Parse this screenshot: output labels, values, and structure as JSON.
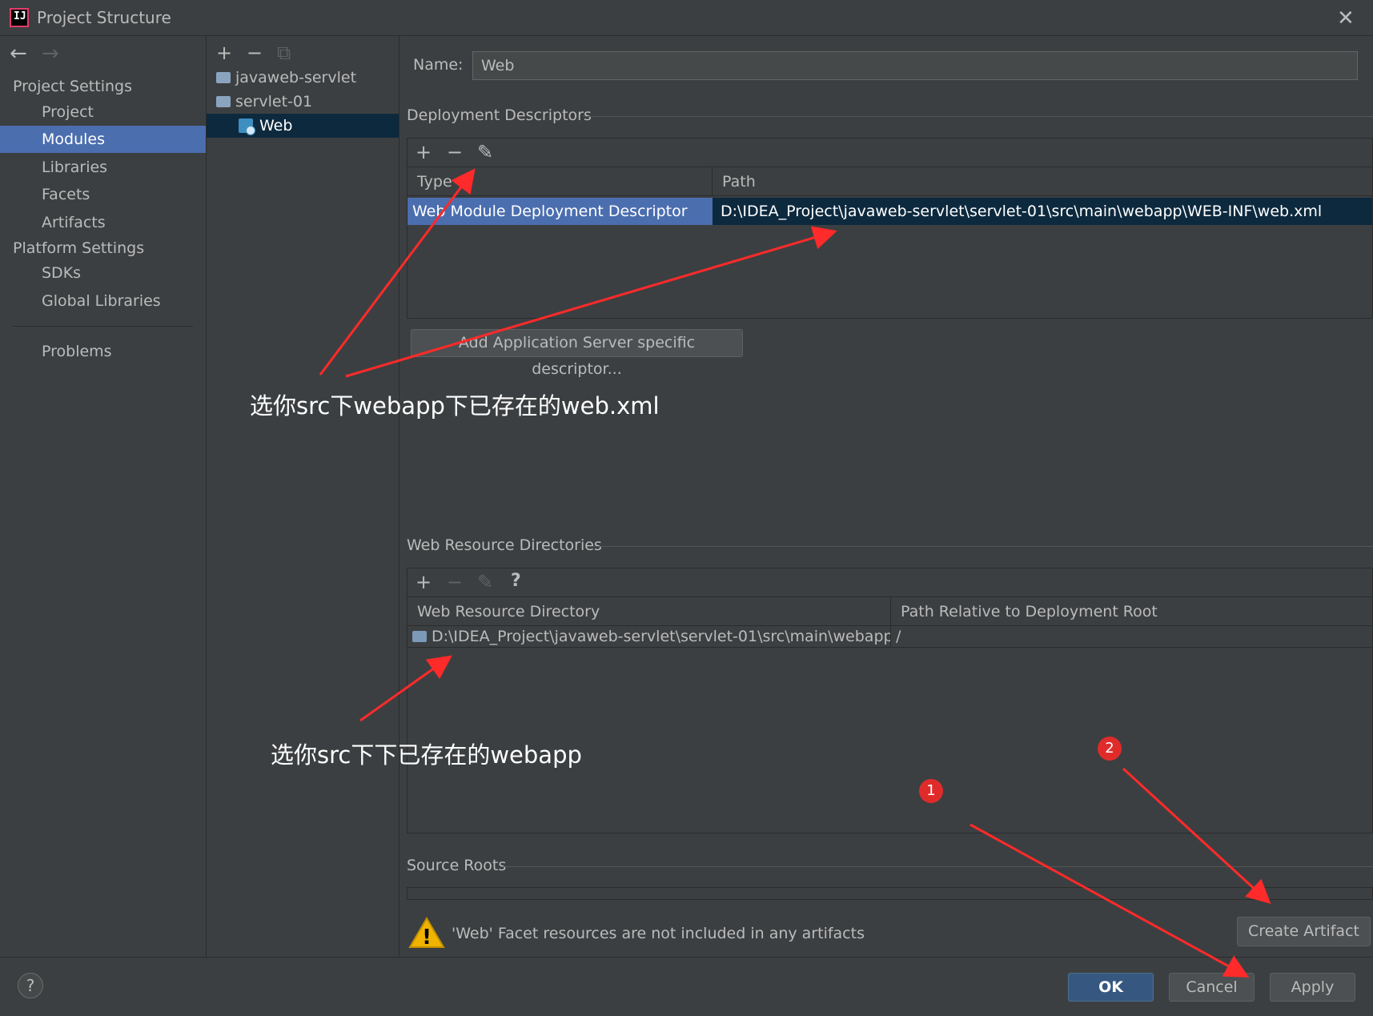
{
  "window": {
    "title": "Project Structure"
  },
  "icons": {
    "back": "←",
    "forward": "→",
    "add": "+",
    "remove": "−",
    "copy": "⧉",
    "edit": "✎",
    "help": "?",
    "close": "✕",
    "warning": "!"
  },
  "sidebar": {
    "project_settings_header": "Project Settings",
    "project_items": [
      "Project",
      "Modules",
      "Libraries",
      "Facets",
      "Artifacts"
    ],
    "platform_settings_header": "Platform Settings",
    "platform_items": [
      "SDKs",
      "Global Libraries"
    ],
    "problems": "Problems",
    "selected": "Modules"
  },
  "tree": {
    "items": [
      {
        "label": "javaweb-servlet"
      },
      {
        "label": "servlet-01"
      },
      {
        "label": "Web"
      }
    ],
    "selected": "Web"
  },
  "facet": {
    "name_label": "Name:",
    "name_value": "Web",
    "deployment_descriptors": {
      "title": "Deployment Descriptors",
      "columns": [
        "Type",
        "Path"
      ],
      "rows": [
        {
          "type": "Web Module Deployment Descriptor",
          "path": "D:\\IDEA_Project\\javaweb-servlet\\servlet-01\\src\\main\\webapp\\WEB-INF\\web.xml"
        }
      ],
      "add_server_button": "Add Application Server specific descriptor..."
    },
    "web_resource_directories": {
      "title": "Web Resource Directories",
      "columns": [
        "Web Resource Directory",
        "Path Relative to Deployment Root"
      ],
      "rows": [
        {
          "directory": "D:\\IDEA_Project\\javaweb-servlet\\servlet-01\\src\\main\\webapp",
          "relative": "/"
        }
      ]
    },
    "source_roots": {
      "title": "Source Roots"
    },
    "warning_text": "'Web' Facet resources are not included in any artifacts",
    "create_artifact_button": "Create Artifact"
  },
  "footer": {
    "ok": "OK",
    "cancel": "Cancel",
    "apply": "Apply"
  },
  "annotations": {
    "note1": "选你src下webapp下已存在的web.xml",
    "note2": "选你src下下已存在的webapp",
    "badge1": "1",
    "badge2": "2",
    "arrow_color": "#ff2a2a"
  }
}
